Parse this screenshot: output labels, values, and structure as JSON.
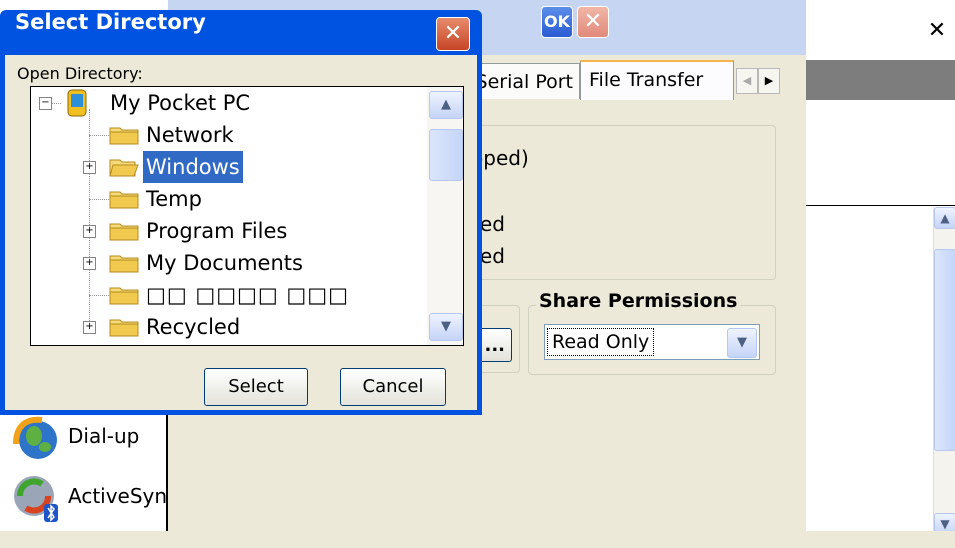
{
  "background": {
    "close_label": "✕",
    "left_list": [
      {
        "label": "Dial-up",
        "icon": "dialup-globe-icon"
      },
      {
        "label": "ActiveSync",
        "icon": "activesync-bluetooth-icon"
      }
    ],
    "second_dialog": {
      "ok_label": "OK",
      "close_label": "✕",
      "tabs": [
        "Serial Port",
        "File Transfer"
      ],
      "status_text": "(Stopped)",
      "line_a": "Disabled",
      "line_b": "Disabled",
      "browse_label": "...",
      "share_permissions_label": "Share Permissions",
      "share_permissions_value": "Read Only"
    }
  },
  "dialog": {
    "title": "Select Directory",
    "close_label": "✕",
    "open_directory_label": "Open Directory:",
    "tree": [
      {
        "label": "My Pocket PC",
        "level": 0,
        "expander": "minus",
        "icon": "pocket-pc-device-icon",
        "selected": false
      },
      {
        "label": "Network",
        "level": 1,
        "expander": "none",
        "icon": "folder-icon",
        "selected": false
      },
      {
        "label": "Windows",
        "level": 1,
        "expander": "plus",
        "icon": "folder-open-icon",
        "selected": true
      },
      {
        "label": "Temp",
        "level": 1,
        "expander": "none",
        "icon": "folder-icon",
        "selected": false
      },
      {
        "label": "Program Files",
        "level": 1,
        "expander": "plus",
        "icon": "folder-icon",
        "selected": false
      },
      {
        "label": "My Documents",
        "level": 1,
        "expander": "plus",
        "icon": "folder-icon",
        "selected": false
      },
      {
        "label": "□□ □□□□ □□□",
        "level": 1,
        "expander": "none",
        "icon": "folder-icon",
        "selected": false
      },
      {
        "label": "Recycled",
        "level": 1,
        "expander": "plus",
        "icon": "folder-icon",
        "selected": false
      }
    ],
    "select_label": "Select",
    "cancel_label": "Cancel"
  },
  "colors": {
    "title_bar": "#0052e0",
    "selection": "#316ac5",
    "dialog_face": "#ece9d8",
    "close_red": "#c64526"
  }
}
